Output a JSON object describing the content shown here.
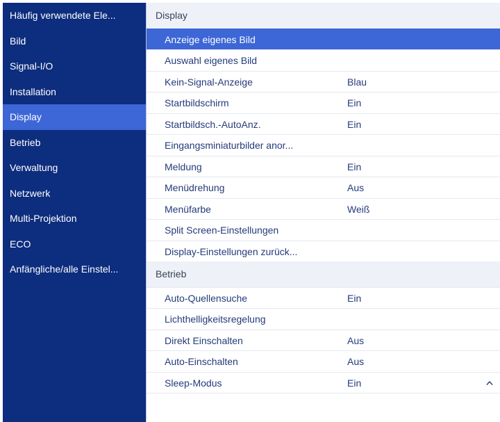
{
  "sidebar": {
    "items": [
      {
        "label": "Häufig verwendete Ele..."
      },
      {
        "label": "Bild"
      },
      {
        "label": "Signal-I/O"
      },
      {
        "label": "Installation"
      },
      {
        "label": "Display"
      },
      {
        "label": "Betrieb"
      },
      {
        "label": "Verwaltung"
      },
      {
        "label": "Netzwerk"
      },
      {
        "label": "Multi-Projektion"
      },
      {
        "label": "ECO"
      },
      {
        "label": "Anfängliche/alle Einstel..."
      }
    ],
    "selected": "Display"
  },
  "sections": [
    {
      "header": "Display",
      "rows": [
        {
          "label": "Anzeige eigenes Bild",
          "value": ""
        },
        {
          "label": "Auswahl eigenes Bild",
          "value": ""
        },
        {
          "label": "Kein-Signal-Anzeige",
          "value": "Blau"
        },
        {
          "label": "Startbildschirm",
          "value": "Ein"
        },
        {
          "label": "Startbildsch.-AutoAnz.",
          "value": "Ein"
        },
        {
          "label": "Eingangsminiaturbilder anor...",
          "value": ""
        },
        {
          "label": "Meldung",
          "value": "Ein"
        },
        {
          "label": "Menüdrehung",
          "value": "Aus"
        },
        {
          "label": "Menüfarbe",
          "value": "Weiß"
        },
        {
          "label": "Split Screen-Einstellungen",
          "value": ""
        },
        {
          "label": "Display-Einstellungen zurück...",
          "value": ""
        }
      ]
    },
    {
      "header": "Betrieb",
      "rows": [
        {
          "label": "Auto-Quellensuche",
          "value": "Ein"
        },
        {
          "label": "Lichthelligkeitsregelung",
          "value": ""
        },
        {
          "label": "Direkt Einschalten",
          "value": "Aus"
        },
        {
          "label": "Auto-Einschalten",
          "value": "Aus"
        },
        {
          "label": "Sleep-Modus",
          "value": "Ein"
        }
      ]
    }
  ],
  "colors": {
    "sidebar_bg": "#0d2d7e",
    "selection": "#3d66d6",
    "section_header_bg": "#eef1f7",
    "row_text": "#243b7a"
  },
  "icons": {
    "scroll_indicator": "chevron-up-icon"
  }
}
